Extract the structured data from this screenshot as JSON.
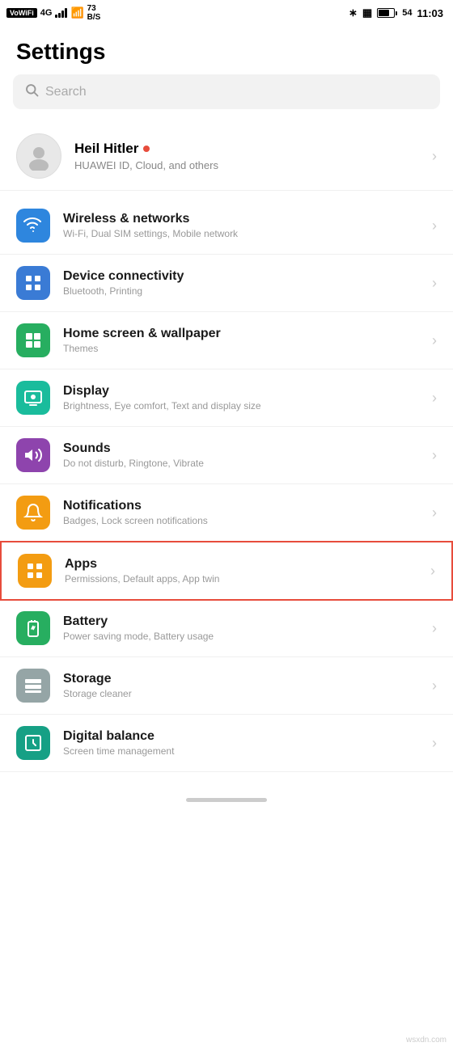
{
  "statusBar": {
    "left": {
      "wifiLabel": "VoWiFi",
      "network": "4G",
      "speed": "73\nB/S"
    },
    "right": {
      "battery": "54",
      "time": "11:03"
    }
  },
  "pageTitle": "Settings",
  "search": {
    "placeholder": "Search"
  },
  "profile": {
    "name": "Heil Hitler",
    "subtitle": "HUAWEI ID, Cloud, and others"
  },
  "settingsItems": [
    {
      "id": "wireless",
      "title": "Wireless & networks",
      "subtitle": "Wi-Fi, Dual SIM settings, Mobile network",
      "iconColor": "blue",
      "iconType": "wifi"
    },
    {
      "id": "connectivity",
      "title": "Device connectivity",
      "subtitle": "Bluetooth, Printing",
      "iconColor": "blue2",
      "iconType": "device"
    },
    {
      "id": "homescreen",
      "title": "Home screen & wallpaper",
      "subtitle": "Themes",
      "iconColor": "green",
      "iconType": "home"
    },
    {
      "id": "display",
      "title": "Display",
      "subtitle": "Brightness, Eye comfort, Text and display size",
      "iconColor": "teal",
      "iconType": "display"
    },
    {
      "id": "sounds",
      "title": "Sounds",
      "subtitle": "Do not disturb, Ringtone, Vibrate",
      "iconColor": "purple",
      "iconType": "sound"
    },
    {
      "id": "notifications",
      "title": "Notifications",
      "subtitle": "Badges, Lock screen notifications",
      "iconColor": "yellow",
      "iconType": "bell"
    },
    {
      "id": "apps",
      "title": "Apps",
      "subtitle": "Permissions, Default apps, App twin",
      "iconColor": "yellow2",
      "iconType": "apps",
      "highlighted": true
    },
    {
      "id": "battery",
      "title": "Battery",
      "subtitle": "Power saving mode, Battery usage",
      "iconColor": "green2",
      "iconType": "battery"
    },
    {
      "id": "storage",
      "title": "Storage",
      "subtitle": "Storage cleaner",
      "iconColor": "gray",
      "iconType": "storage"
    },
    {
      "id": "digital",
      "title": "Digital balance",
      "subtitle": "Screen time management",
      "iconColor": "teal2",
      "iconType": "balance"
    }
  ]
}
